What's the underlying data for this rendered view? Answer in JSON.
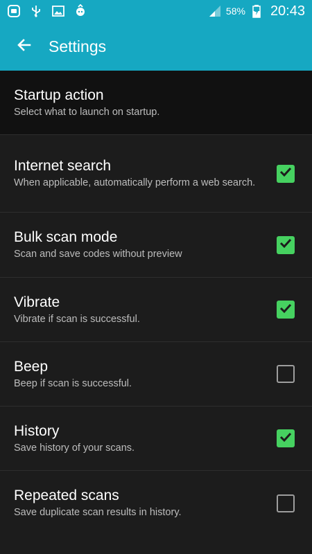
{
  "status_bar": {
    "battery_percent": "58%",
    "time": "20:43"
  },
  "app_bar": {
    "title": "Settings"
  },
  "settings": [
    {
      "id": "startup-action",
      "title": "Startup action",
      "summary": "Select what to launch on startup.",
      "has_checkbox": false
    },
    {
      "id": "internet-search",
      "title": "Internet search",
      "summary": "When applicable, automatically perform a web search.",
      "has_checkbox": true,
      "checked": true
    },
    {
      "id": "bulk-scan-mode",
      "title": "Bulk scan mode",
      "summary": "Scan and save codes without preview",
      "has_checkbox": true,
      "checked": true
    },
    {
      "id": "vibrate",
      "title": "Vibrate",
      "summary": "Vibrate if scan is successful.",
      "has_checkbox": true,
      "checked": true
    },
    {
      "id": "beep",
      "title": "Beep",
      "summary": "Beep if scan is successful.",
      "has_checkbox": true,
      "checked": false
    },
    {
      "id": "history",
      "title": "History",
      "summary": "Save history of your scans.",
      "has_checkbox": true,
      "checked": true
    },
    {
      "id": "repeated-scans",
      "title": "Repeated scans",
      "summary": "Save duplicate scan results in history.",
      "has_checkbox": true,
      "checked": false
    }
  ],
  "colors": {
    "primary": "#16a8c2",
    "checkbox_checked": "#46d160",
    "background": "#1c1c1c"
  }
}
